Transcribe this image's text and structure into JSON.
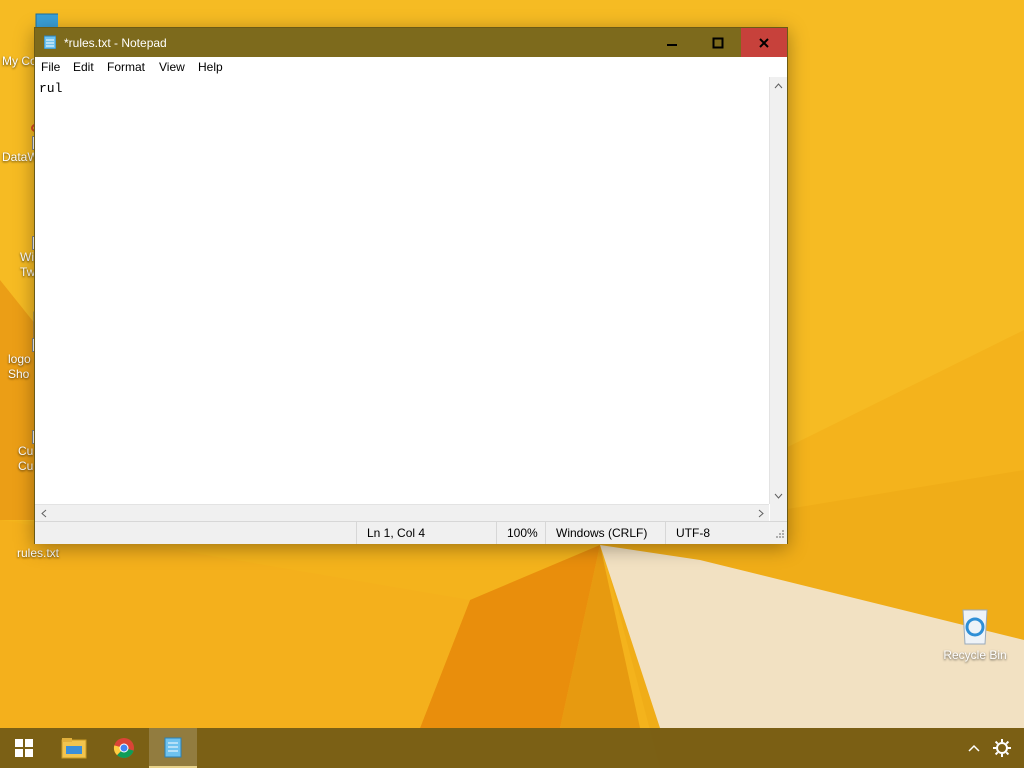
{
  "desktop": {
    "icons": [
      {
        "label": "My Co"
      },
      {
        "label": "DataW"
      },
      {
        "label": "Wi\nTw"
      },
      {
        "label": "logo\nSho"
      },
      {
        "label": "Cu\nCu"
      },
      {
        "label": "rules.txt"
      },
      {
        "label": "Recycle Bin"
      }
    ]
  },
  "window": {
    "title": "*rules.txt - Notepad",
    "menu": [
      "File",
      "Edit",
      "Format",
      "View",
      "Help"
    ],
    "content": "rul",
    "status": {
      "position": "Ln 1, Col 4",
      "zoom": "100%",
      "line_ending": "Windows (CRLF)",
      "encoding": "UTF-8"
    }
  },
  "taskbar": {
    "items": [
      "start-icon",
      "file-explorer-icon",
      "chrome-icon",
      "notepad-icon"
    ],
    "tray": [
      "chevron-up-icon",
      "settings-icon"
    ]
  },
  "colors": {
    "titlebar": "#7d6a1c",
    "close": "#c7413b",
    "wallpaper": "#f3b21b"
  }
}
